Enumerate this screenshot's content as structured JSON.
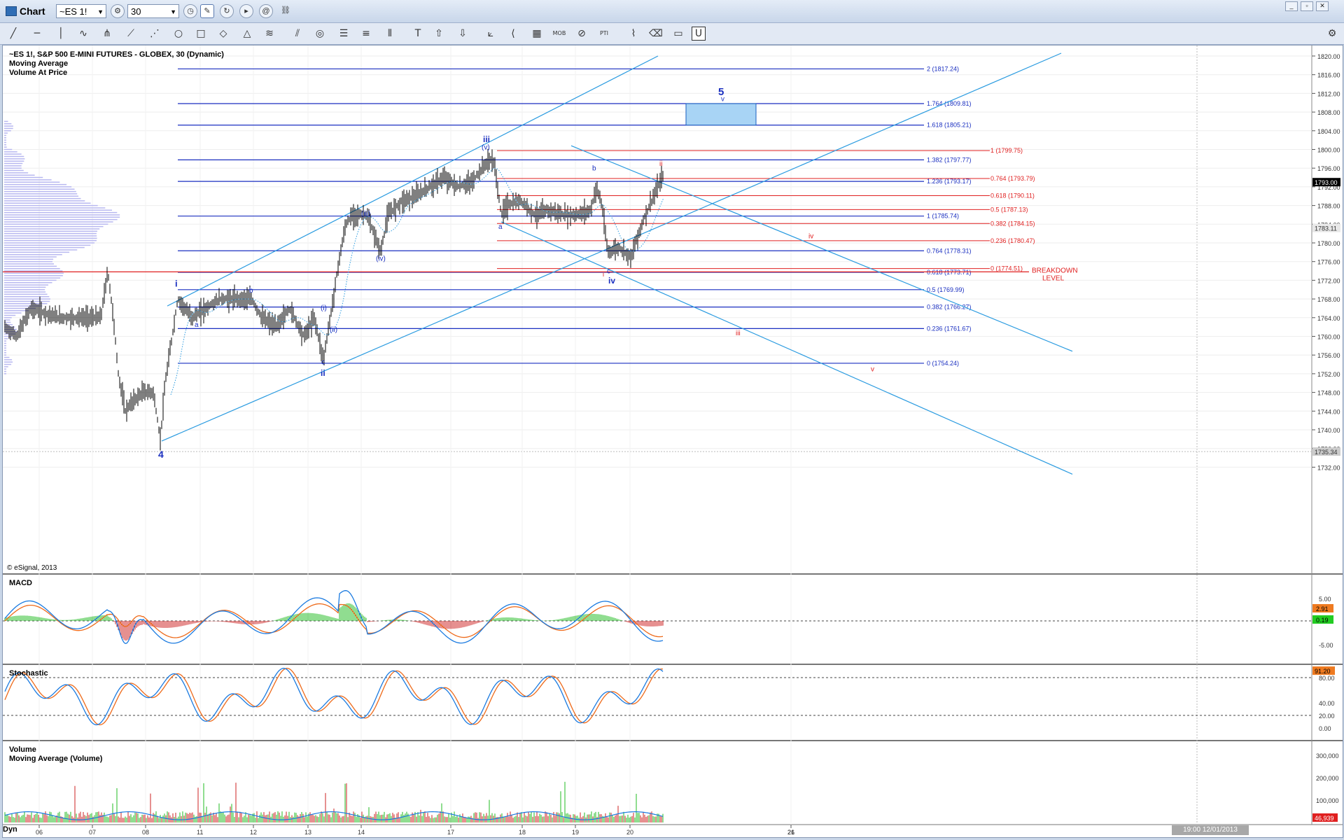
{
  "window": {
    "title": "Chart",
    "symbol": "~ES 1!",
    "interval": "30",
    "controls": {
      "minimize": "_",
      "restore": "▫",
      "close": "✕"
    }
  },
  "toolbar_icons": [
    "trendline-icon",
    "horizontal-line-icon",
    "vertical-line-icon",
    "freehand-icon",
    "pitchfork-icon",
    "fan-icon",
    "gann-icon",
    "ellipse-icon",
    "rectangle-icon",
    "pencil-icon",
    "triangle-icon",
    "channel-icon",
    "parallel-icon",
    "cycle-icon",
    "fib-retracement-icon",
    "fib-extension-icon",
    "fib-time-icon",
    "text-icon",
    "arrow-up-icon",
    "arrow-down-icon",
    "regression-icon",
    "speed-icon",
    "grid-icon",
    "mob-icon",
    "ruler-icon",
    "pti-icon",
    "wave-icon",
    "eraser-icon",
    "note-icon",
    "magnet-icon"
  ],
  "header": {
    "line1": "~ES 1!, S&P 500 E-MINI FUTURES - GLOBEX, 30 (Dynamic)",
    "line2": "Moving Average",
    "line3": "Volume At Price",
    "copyright": "© eSignal, 2013"
  },
  "price_axis": {
    "ticks": [
      "1820.00",
      "1816.00",
      "1812.00",
      "1808.00",
      "1804.00",
      "1800.00",
      "1796.00",
      "1792.00",
      "1788.00",
      "1784.00",
      "1780.00",
      "1776.00",
      "1772.00",
      "1768.00",
      "1764.00",
      "1760.00",
      "1756.00",
      "1752.00",
      "1748.00",
      "1744.00",
      "1740.00",
      "1736.00",
      "1732.00"
    ],
    "last_price": "1793.00",
    "ma_value": "1783.11",
    "low_value": "1735.34"
  },
  "date_axis": [
    "06",
    "07",
    "08",
    "11",
    "12",
    "13",
    "14",
    "17",
    "18",
    "19",
    "20",
    "21",
    "26"
  ],
  "date_stamp": "19:00 12/01/2013",
  "fib_blue": [
    "2 (1817.24)",
    "1.764 (1809.81)",
    "1.618 (1805.21)",
    "1.382 (1797.77)",
    "1.236 (1793.17)",
    "1 (1785.74)",
    "0.764 (1778.31)",
    "0.618 (1773.71)",
    "0.5 (1769.99)",
    "0.382 (1766.27)",
    "0.236 (1761.67)",
    "0 (1754.24)"
  ],
  "fib_red": [
    "1 (1799.75)",
    "0.764 (1793.79)",
    "0.618 (1790.11)",
    "0.5 (1787.13)",
    "0.382 (1784.15)",
    "0.236 (1780.47)",
    "0 (1774.51)"
  ],
  "breakdown": {
    "line1": "BREAKDOWN",
    "line2": "LEVEL"
  },
  "wave_labels": {
    "w4": "4",
    "wi": "i",
    "wb1": "b",
    "wa1": "a",
    "wc1": "c",
    "wii": "ii",
    "wi_small": "(i)",
    "wii_small": "(ii)",
    "wiii_small": "(iii)",
    "wiv_small": "(iv)",
    "wv_small": "(v)",
    "wiii": "iii",
    "wa2": "a",
    "wb2": "b",
    "wc2": "c",
    "wiv": "iv",
    "w5": "5",
    "wv": "v",
    "ri_small": "i",
    "rii": "ii",
    "riii": "iii",
    "riv": "iv",
    "rv": "v"
  },
  "macd": {
    "label": "MACD",
    "ticks": [
      "5.00",
      "0.00",
      "-5.00"
    ],
    "val1": "2.91",
    "val2": "0.19"
  },
  "stochastic": {
    "label": "Stochastic",
    "ticks": [
      "80.00",
      "40.00",
      "20.00",
      "0.00"
    ],
    "val1": "91.20"
  },
  "volume": {
    "label": "Volume",
    "sublabel": "Moving Average (Volume)",
    "ticks": [
      "300,000",
      "200,000",
      "100,000"
    ],
    "val1": "46,939"
  },
  "footer": {
    "mode": "Dyn"
  },
  "colors": {
    "blue_fib": "#1a2fc0",
    "red_fib": "#e02020",
    "channel": "#2a9be0",
    "price": "#000000",
    "green_bar": "#22bb22",
    "red_bar": "#cc2020"
  }
}
